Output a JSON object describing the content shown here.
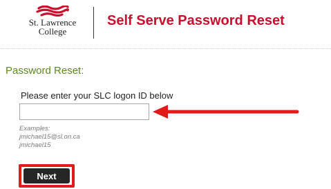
{
  "header": {
    "logo_line1": "St. Lawrence",
    "logo_line2": "College",
    "title": "Self Serve Password Reset"
  },
  "form": {
    "heading": "Password Reset:",
    "label": "Please enter your SLC logon ID below",
    "input_value": "",
    "examples_title": "Examples:",
    "examples": [
      "jmichael15@sl.on.ca",
      "jmichael15"
    ],
    "next_label": "Next"
  },
  "colors": {
    "brand_red": "#c8102e",
    "heading_green": "#5a8a1e",
    "annotation_red": "#e21a1a",
    "button_dark": "#262626"
  },
  "icons": {
    "logo_mark": "wave-logo-icon",
    "annotation": "red-arrow-icon"
  }
}
